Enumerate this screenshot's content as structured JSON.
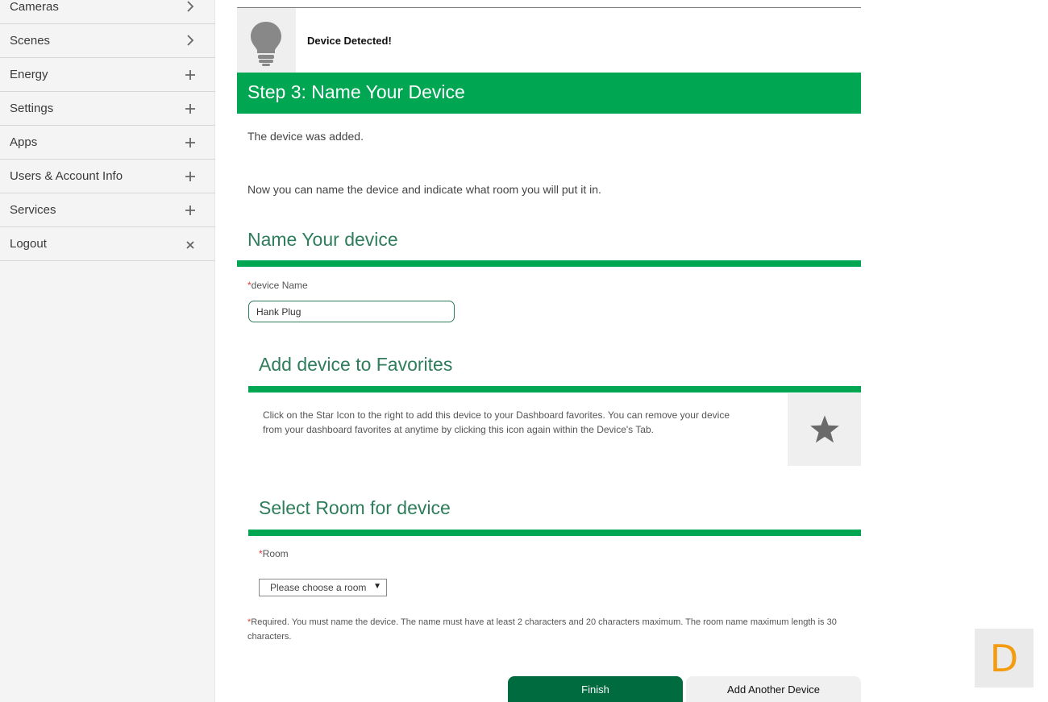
{
  "sidebar": {
    "items": [
      {
        "label": "Cameras",
        "icon": "chevron-right-icon"
      },
      {
        "label": "Scenes",
        "icon": "chevron-right-icon"
      },
      {
        "label": "Energy",
        "icon": "plus-icon"
      },
      {
        "label": "Settings",
        "icon": "plus-icon"
      },
      {
        "label": "Apps",
        "icon": "plus-icon"
      },
      {
        "label": "Users & Account Info",
        "icon": "plus-icon"
      },
      {
        "label": "Services",
        "icon": "plus-icon"
      },
      {
        "label": "Logout",
        "icon": "close-icon"
      }
    ]
  },
  "detected": {
    "icon": "lightbulb-icon",
    "text": "Device Detected!"
  },
  "step": {
    "title": "Step 3: Name Your Device"
  },
  "intro": {
    "added": "The device was added.",
    "instructions": "Now you can name the device and indicate what room you will put it in."
  },
  "name_section": {
    "title": "Name Your device",
    "required_mark": "*",
    "field_label": "device Name",
    "field_value": "Hank Plug"
  },
  "favorites_section": {
    "title": "Add device to Favorites",
    "description": "Click on the Star Icon to the right to add this device to your Dashboard favorites. You can remove your device from your dashboard favorites at anytime by clicking this icon again within the Device's Tab.",
    "star_icon": "star-icon"
  },
  "room_section": {
    "title": "Select Room for device",
    "required_mark": "*",
    "field_label": "Room",
    "select_value": "Please choose a room",
    "select_arrow": "▼"
  },
  "note": {
    "required_mark": "*",
    "text": "Required. You must name the device. The name must have at least 2 characters and 20 characters maximum. The room name maximum length is 30 characters."
  },
  "buttons": {
    "finish": "Finish",
    "add_another": "Add Another Device"
  },
  "badge": {
    "letter": "D"
  },
  "colors": {
    "brand_green": "#00a651",
    "dark_green": "#006b3f",
    "heading_green": "#2e7d5b",
    "required_red": "#e53935",
    "badge_orange": "#f39c12"
  }
}
